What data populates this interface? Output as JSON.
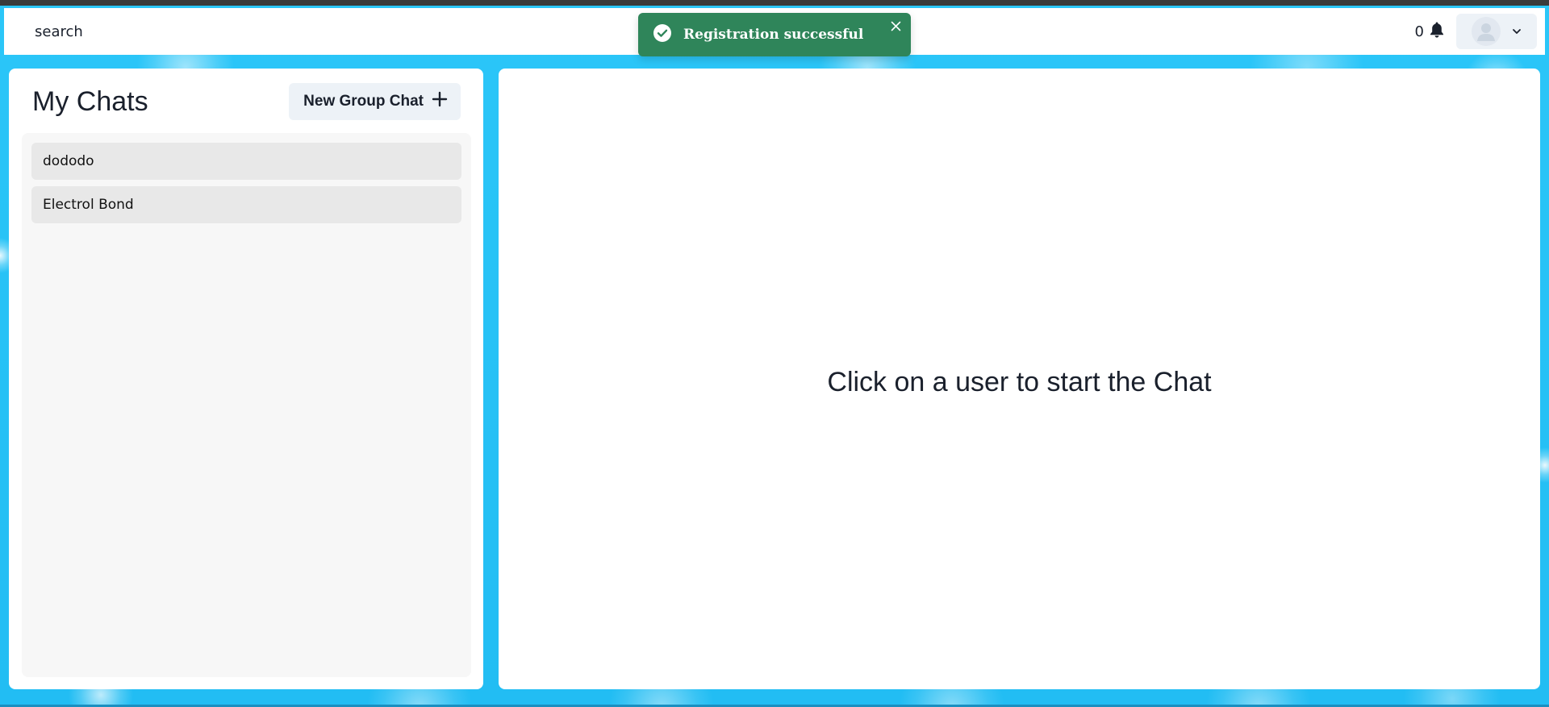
{
  "header": {
    "search_label": "search",
    "notification_count": "0"
  },
  "toast": {
    "message": "Registration successful",
    "status": "success",
    "color": "#2f855a"
  },
  "chats": {
    "title": "My Chats",
    "new_group_label": "New Group Chat",
    "items": [
      {
        "label": "dododo"
      },
      {
        "label": "Electrol Bond"
      }
    ]
  },
  "main": {
    "empty_message": "Click on a user to start the Chat"
  },
  "icons": {
    "notification": "bell-icon",
    "profile": "user-avatar-icon",
    "dropdown": "chevron-down-icon",
    "toast_status": "check-circle-icon",
    "toast_close": "close-icon",
    "add": "plus-icon"
  },
  "colors": {
    "background": "#29c2f6",
    "panel": "#ffffff",
    "chat_item": "#e8e8e8",
    "button": "#edf2f7"
  }
}
